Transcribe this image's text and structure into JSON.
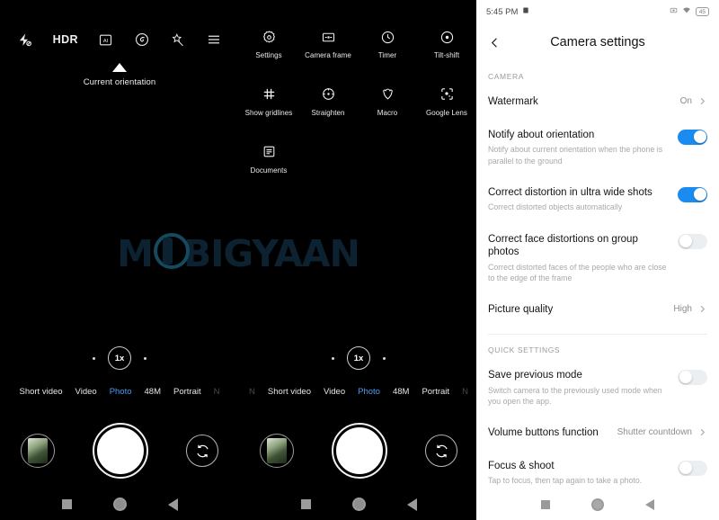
{
  "camera": {
    "toolbar": [
      {
        "name": "flash-off-icon",
        "label": ""
      },
      {
        "name": "hdr-icon",
        "label": "HDR"
      },
      {
        "name": "ai-icon",
        "label": ""
      },
      {
        "name": "bokeh-icon",
        "label": ""
      },
      {
        "name": "beautify-icon",
        "label": ""
      },
      {
        "name": "menu-icon",
        "label": ""
      }
    ],
    "orientation_label": "Current orientation",
    "menu_items": [
      {
        "label": "Settings",
        "icon": "gear-icon"
      },
      {
        "label": "Camera frame",
        "icon": "frame-ratio-icon"
      },
      {
        "label": "Timer",
        "icon": "clock-icon"
      },
      {
        "label": "Tilt-shift",
        "icon": "tilt-shift-icon"
      },
      {
        "label": "Show gridlines",
        "icon": "grid-icon"
      },
      {
        "label": "Straighten",
        "icon": "straighten-icon"
      },
      {
        "label": "Macro",
        "icon": "macro-flower-icon"
      },
      {
        "label": "Google Lens",
        "icon": "google-lens-icon"
      },
      {
        "label": "Documents",
        "icon": "document-icon"
      }
    ],
    "watermark_text_start": "M",
    "watermark_text_end": "BIGYAAN",
    "zoom_level": "1x",
    "modes": [
      "Short video",
      "Video",
      "Photo",
      "48M",
      "Portrait"
    ],
    "selected_mode": "Photo",
    "mode_edge_left": "N",
    "mode_edge_right": "N",
    "shutter_label": "shutter",
    "accent_blue": "#4a9cf6"
  },
  "settings": {
    "status": {
      "time": "5:45 PM",
      "left_icon": "sim-icon",
      "right_icons": [
        "screenshot-icon",
        "wifi-icon"
      ],
      "battery": "45"
    },
    "title": "Camera settings",
    "sections": [
      {
        "header": "CAMERA",
        "rows": [
          {
            "title": "Watermark",
            "sub": "",
            "control": "value-chevron",
            "value": "On"
          },
          {
            "title": "Notify about orientation",
            "sub": "Notify about current orientation when the phone is parallel to the ground",
            "control": "toggle",
            "value": "on"
          },
          {
            "title": "Correct distortion in ultra wide shots",
            "sub": "Correct distorted objects automatically",
            "control": "toggle",
            "value": "on"
          },
          {
            "title": "Correct face distortions on group photos",
            "sub": "Correct distorted faces of the people who are close to the edge of the frame",
            "control": "toggle",
            "value": "off"
          },
          {
            "title": "Picture quality",
            "sub": "",
            "control": "value-chevron",
            "value": "High"
          }
        ]
      },
      {
        "header": "QUICK SETTINGS",
        "rows": [
          {
            "title": "Save previous mode",
            "sub": "Switch camera to the previously used mode when you open the app.",
            "control": "toggle",
            "value": "off"
          },
          {
            "title": "Volume buttons function",
            "sub": "",
            "control": "value-chevron",
            "value": "Shutter countdown"
          },
          {
            "title": "Focus & shoot",
            "sub": "Tap to focus, then tap again to take a photo.",
            "control": "toggle",
            "value": "off"
          }
        ]
      }
    ],
    "toggle_on_color": "#1a8cf1"
  }
}
